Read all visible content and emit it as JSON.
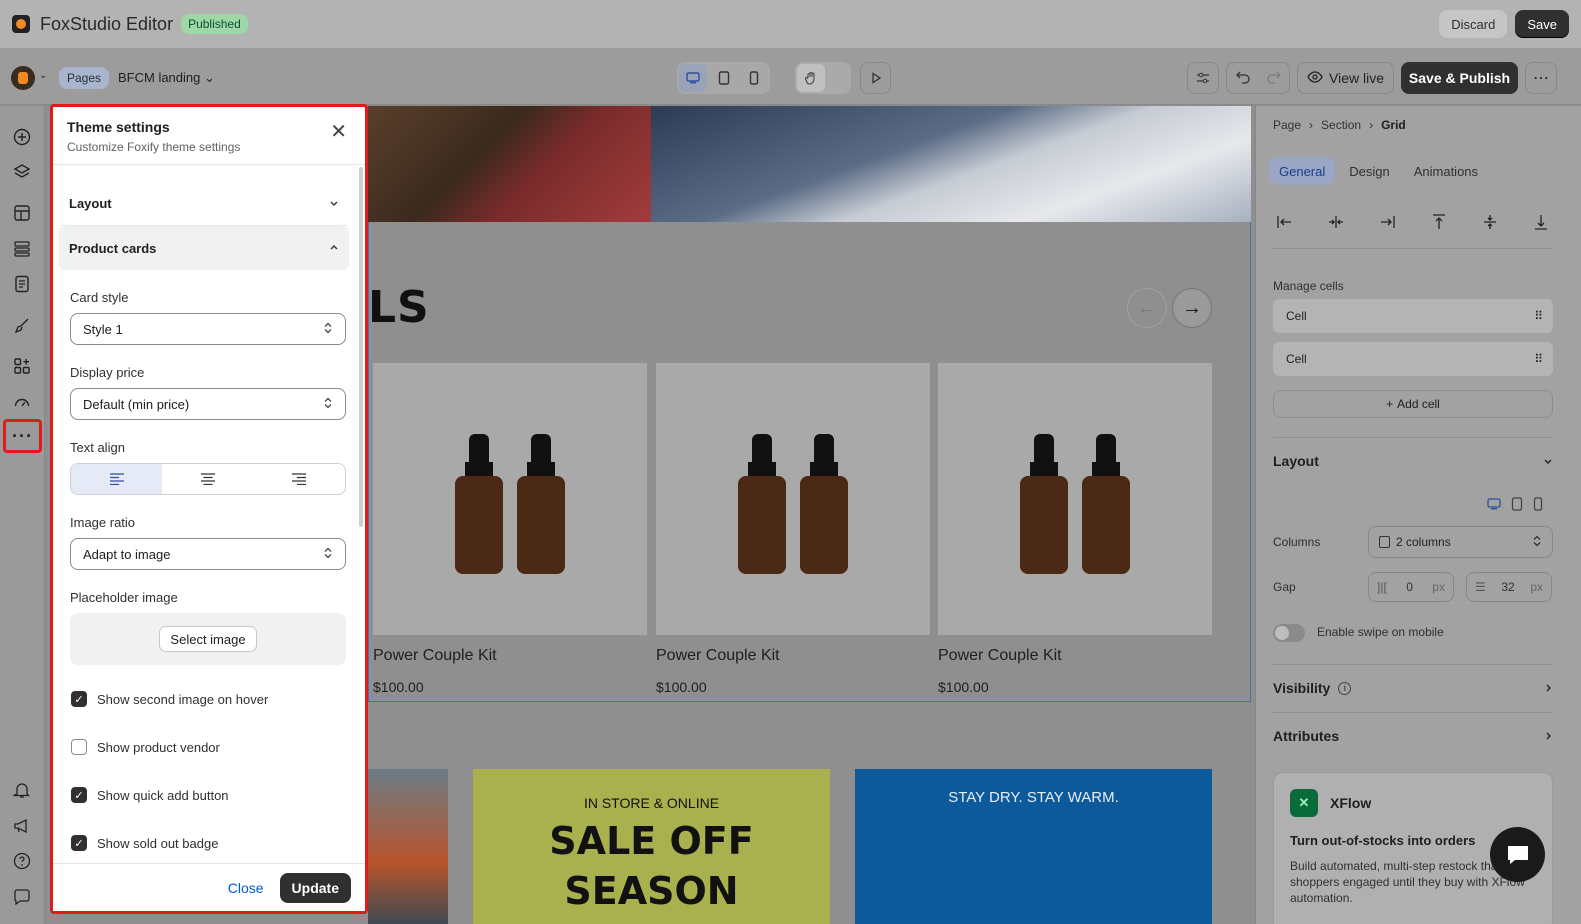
{
  "app": {
    "title": "FoxStudio Editor",
    "status": "Published",
    "discard_label": "Discard",
    "save_label": "Save"
  },
  "toolbar": {
    "section": "Pages",
    "page": "BFCM landing",
    "view_live": "View live",
    "save_publish": "Save & Publish"
  },
  "canvas": {
    "heading_fragment": "LS",
    "products": [
      {
        "name": "Power Couple Kit",
        "price": "$100.00"
      },
      {
        "name": "Power Couple Kit",
        "price": "$100.00"
      },
      {
        "name": "Power Couple Kit",
        "price": "$100.00"
      }
    ],
    "banner_center": {
      "small": "IN STORE & ONLINE",
      "line1": "SALE OFF",
      "line2": "SEASON"
    },
    "banner_right": {
      "small": "STAY DRY. STAY WARM."
    }
  },
  "theme_panel": {
    "title": "Theme settings",
    "subtitle": "Customize Foxify theme settings",
    "sections": {
      "layout": "Layout",
      "product_cards": "Product cards"
    },
    "card_style": {
      "label": "Card style",
      "value": "Style 1"
    },
    "display_price": {
      "label": "Display price",
      "value": "Default (min price)"
    },
    "text_align": {
      "label": "Text align",
      "selected": "left"
    },
    "image_ratio": {
      "label": "Image ratio",
      "value": "Adapt to image"
    },
    "placeholder": {
      "label": "Placeholder image",
      "button": "Select image"
    },
    "checkboxes": [
      {
        "label": "Show second image on hover",
        "checked": true
      },
      {
        "label": "Show product vendor",
        "checked": false
      },
      {
        "label": "Show quick add button",
        "checked": true
      },
      {
        "label": "Show sold out badge",
        "checked": true
      }
    ],
    "close_label": "Close",
    "update_label": "Update"
  },
  "right_panel": {
    "breadcrumb": [
      "Page",
      "Section",
      "Grid"
    ],
    "tabs": [
      "General",
      "Design",
      "Animations"
    ],
    "manage_cells": "Manage cells",
    "cells": [
      "Cell",
      "Cell"
    ],
    "add_cell": "Add cell",
    "layout_title": "Layout",
    "columns_label": "Columns",
    "columns_value": "2 columns",
    "gap_label": "Gap",
    "gap_h": "0",
    "gap_v": "32",
    "gap_unit": "px",
    "swipe_label": "Enable swipe on mobile",
    "visibility": "Visibility",
    "attributes": "Attributes",
    "promo": {
      "name": "XFlow",
      "headline": "Turn out-of-stocks into orders",
      "body": "Build automated, multi-step restock that keep shoppers engaged until they buy with XFlow automation."
    }
  },
  "colors": {
    "highlight": "#e01b1b",
    "accent": "#005bd3",
    "published": "#9fd8a7"
  }
}
